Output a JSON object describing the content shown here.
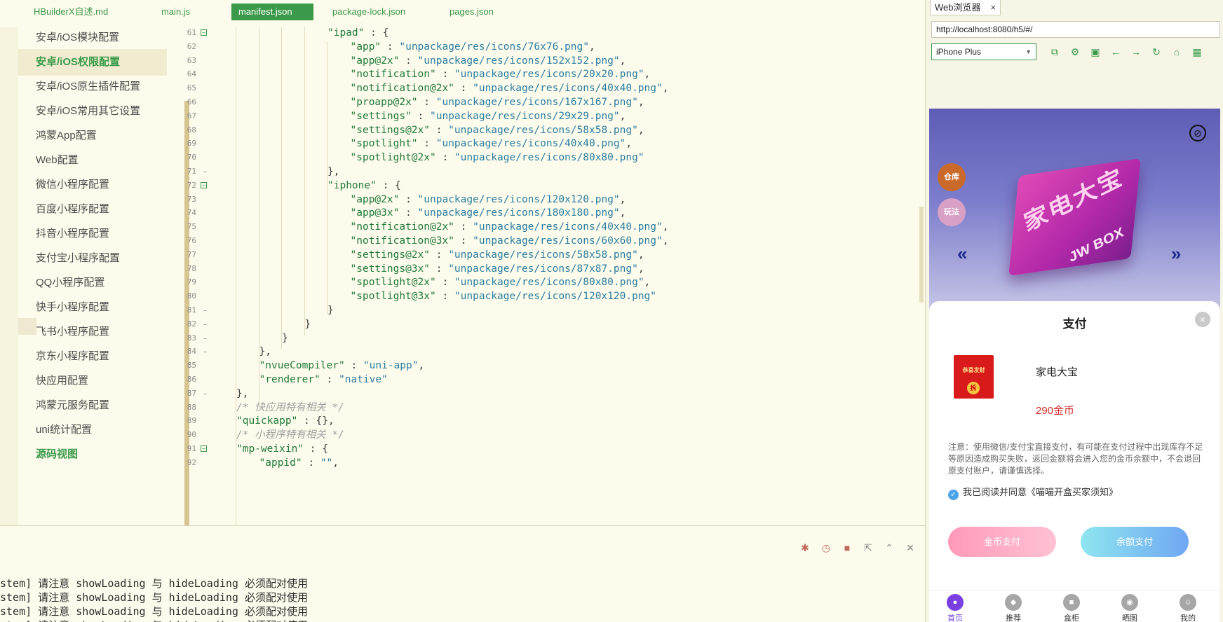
{
  "editor": {
    "tabs": [
      {
        "label": "HBuilderX自述.md",
        "active": false
      },
      {
        "label": "main.js",
        "active": false
      },
      {
        "label": "manifest.json",
        "active": true
      },
      {
        "label": "package-lock.json",
        "active": false
      },
      {
        "label": "pages.json",
        "active": false
      }
    ],
    "sidebar": [
      {
        "label": "安卓/iOS模块配置",
        "state": "normal"
      },
      {
        "label": "安卓/iOS权限配置",
        "state": "active"
      },
      {
        "label": "安卓/iOS原生插件配置",
        "state": "normal"
      },
      {
        "label": "安卓/iOS常用其它设置",
        "state": "normal"
      },
      {
        "label": "鸿蒙App配置",
        "state": "normal"
      },
      {
        "label": "Web配置",
        "state": "normal"
      },
      {
        "label": "微信小程序配置",
        "state": "normal"
      },
      {
        "label": "百度小程序配置",
        "state": "normal"
      },
      {
        "label": "抖音小程序配置",
        "state": "normal"
      },
      {
        "label": "支付宝小程序配置",
        "state": "normal"
      },
      {
        "label": "QQ小程序配置",
        "state": "normal"
      },
      {
        "label": "快手小程序配置",
        "state": "normal"
      },
      {
        "label": "飞书小程序配置",
        "state": "normal"
      },
      {
        "label": "京东小程序配置",
        "state": "normal"
      },
      {
        "label": "快应用配置",
        "state": "normal"
      },
      {
        "label": "鸿蒙元服务配置",
        "state": "normal"
      },
      {
        "label": "uni统计配置",
        "state": "normal"
      },
      {
        "label": "源码视图",
        "state": "link"
      }
    ],
    "code_lines": [
      {
        "n": "61",
        "fold": true,
        "indent": 4,
        "tokens": [
          [
            "k",
            "\"ipad\""
          ],
          [
            "p",
            " : {"
          ]
        ]
      },
      {
        "n": "62",
        "indent": 5,
        "tokens": [
          [
            "k",
            "\"app\""
          ],
          [
            "p",
            " : "
          ],
          [
            "s",
            "\"unpackage/res/icons/76x76.png\""
          ],
          [
            "p",
            ","
          ]
        ]
      },
      {
        "n": "63",
        "indent": 5,
        "tokens": [
          [
            "k",
            "\"app@2x\""
          ],
          [
            "p",
            " : "
          ],
          [
            "s",
            "\"unpackage/res/icons/152x152.png\""
          ],
          [
            "p",
            ","
          ]
        ]
      },
      {
        "n": "64",
        "indent": 5,
        "tokens": [
          [
            "k",
            "\"notification\""
          ],
          [
            "p",
            " : "
          ],
          [
            "s",
            "\"unpackage/res/icons/20x20.png\""
          ],
          [
            "p",
            ","
          ]
        ]
      },
      {
        "n": "65",
        "indent": 5,
        "tokens": [
          [
            "k",
            "\"notification@2x\""
          ],
          [
            "p",
            " : "
          ],
          [
            "s",
            "\"unpackage/res/icons/40x40.png\""
          ],
          [
            "p",
            ","
          ]
        ]
      },
      {
        "n": "66",
        "indent": 5,
        "tokens": [
          [
            "k",
            "\"proapp@2x\""
          ],
          [
            "p",
            " : "
          ],
          [
            "s",
            "\"unpackage/res/icons/167x167.png\""
          ],
          [
            "p",
            ","
          ]
        ]
      },
      {
        "n": "67",
        "indent": 5,
        "tokens": [
          [
            "k",
            "\"settings\""
          ],
          [
            "p",
            " : "
          ],
          [
            "s",
            "\"unpackage/res/icons/29x29.png\""
          ],
          [
            "p",
            ","
          ]
        ]
      },
      {
        "n": "68",
        "indent": 5,
        "tokens": [
          [
            "k",
            "\"settings@2x\""
          ],
          [
            "p",
            " : "
          ],
          [
            "s",
            "\"unpackage/res/icons/58x58.png\""
          ],
          [
            "p",
            ","
          ]
        ]
      },
      {
        "n": "69",
        "indent": 5,
        "tokens": [
          [
            "k",
            "\"spotlight\""
          ],
          [
            "p",
            " : "
          ],
          [
            "s",
            "\"unpackage/res/icons/40x40.png\""
          ],
          [
            "p",
            ","
          ]
        ]
      },
      {
        "n": "70",
        "indent": 5,
        "tokens": [
          [
            "k",
            "\"spotlight@2x\""
          ],
          [
            "p",
            " : "
          ],
          [
            "s",
            "\"unpackage/res/icons/80x80.png\""
          ]
        ]
      },
      {
        "n": "71",
        "tick": true,
        "indent": 4,
        "tokens": [
          [
            "p",
            "},"
          ]
        ]
      },
      {
        "n": "72",
        "fold": true,
        "indent": 4,
        "tokens": [
          [
            "k",
            "\"iphone\""
          ],
          [
            "p",
            " : {"
          ]
        ]
      },
      {
        "n": "73",
        "indent": 5,
        "tokens": [
          [
            "k",
            "\"app@2x\""
          ],
          [
            "p",
            " : "
          ],
          [
            "s",
            "\"unpackage/res/icons/120x120.png\""
          ],
          [
            "p",
            ","
          ]
        ]
      },
      {
        "n": "74",
        "indent": 5,
        "tokens": [
          [
            "k",
            "\"app@3x\""
          ],
          [
            "p",
            " : "
          ],
          [
            "s",
            "\"unpackage/res/icons/180x180.png\""
          ],
          [
            "p",
            ","
          ]
        ]
      },
      {
        "n": "75",
        "indent": 5,
        "tokens": [
          [
            "k",
            "\"notification@2x\""
          ],
          [
            "p",
            " : "
          ],
          [
            "s",
            "\"unpackage/res/icons/40x40.png\""
          ],
          [
            "p",
            ","
          ]
        ]
      },
      {
        "n": "76",
        "indent": 5,
        "tokens": [
          [
            "k",
            "\"notification@3x\""
          ],
          [
            "p",
            " : "
          ],
          [
            "s",
            "\"unpackage/res/icons/60x60.png\""
          ],
          [
            "p",
            ","
          ]
        ]
      },
      {
        "n": "77",
        "indent": 5,
        "tokens": [
          [
            "k",
            "\"settings@2x\""
          ],
          [
            "p",
            " : "
          ],
          [
            "s",
            "\"unpackage/res/icons/58x58.png\""
          ],
          [
            "p",
            ","
          ]
        ]
      },
      {
        "n": "78",
        "indent": 5,
        "tokens": [
          [
            "k",
            "\"settings@3x\""
          ],
          [
            "p",
            " : "
          ],
          [
            "s",
            "\"unpackage/res/icons/87x87.png\""
          ],
          [
            "p",
            ","
          ]
        ]
      },
      {
        "n": "79",
        "indent": 5,
        "tokens": [
          [
            "k",
            "\"spotlight@2x\""
          ],
          [
            "p",
            " : "
          ],
          [
            "s",
            "\"unpackage/res/icons/80x80.png\""
          ],
          [
            "p",
            ","
          ]
        ]
      },
      {
        "n": "80",
        "indent": 5,
        "tokens": [
          [
            "k",
            "\"spotlight@3x\""
          ],
          [
            "p",
            " : "
          ],
          [
            "s",
            "\"unpackage/res/icons/120x120.png\""
          ]
        ]
      },
      {
        "n": "81",
        "tick": true,
        "indent": 4,
        "tokens": [
          [
            "p",
            "}"
          ]
        ]
      },
      {
        "n": "82",
        "tick": true,
        "indent": 3,
        "tokens": [
          [
            "p",
            "}"
          ]
        ]
      },
      {
        "n": "83",
        "tick": true,
        "indent": 2,
        "tokens": [
          [
            "p",
            "}"
          ]
        ]
      },
      {
        "n": "84",
        "tick": true,
        "indent": 1,
        "tokens": [
          [
            "p",
            "},"
          ]
        ]
      },
      {
        "n": "85",
        "indent": 1,
        "tokens": [
          [
            "k",
            "\"nvueCompiler\""
          ],
          [
            "p",
            " : "
          ],
          [
            "s",
            "\"uni-app\""
          ],
          [
            "p",
            ","
          ]
        ]
      },
      {
        "n": "86",
        "indent": 1,
        "tokens": [
          [
            "k",
            "\"renderer\""
          ],
          [
            "p",
            " : "
          ],
          [
            "s",
            "\"native\""
          ]
        ]
      },
      {
        "n": "87",
        "tick": true,
        "indent": 0,
        "tokens": [
          [
            "p",
            "},"
          ]
        ]
      },
      {
        "n": "88",
        "indent": 0,
        "tokens": [
          [
            "c",
            "/* 快应用特有相关 */"
          ]
        ]
      },
      {
        "n": "89",
        "indent": 0,
        "tokens": [
          [
            "k",
            "\"quickapp\""
          ],
          [
            "p",
            " : {},"
          ]
        ]
      },
      {
        "n": "90",
        "indent": 0,
        "tokens": [
          [
            "c",
            "/* 小程序特有相关 */"
          ]
        ]
      },
      {
        "n": "91",
        "fold": true,
        "indent": 0,
        "tokens": [
          [
            "k",
            "\"mp-weixin\""
          ],
          [
            "p",
            " : {"
          ]
        ]
      },
      {
        "n": "92",
        "indent": 1,
        "tokens": [
          [
            "k",
            "\"appid\""
          ],
          [
            "p",
            " : "
          ],
          [
            "s",
            "\"\""
          ],
          [
            "p",
            ","
          ]
        ]
      }
    ],
    "console_lines": [
      "stem] 请注意 showLoading 与 hideLoading 必须配对使用",
      "stem] 请注意 showLoading 与 hideLoading 必须配对使用",
      "stem] 请注意 showLoading 与 hideLoading 必须配对使用",
      "stem] 请注意 showLoading 与 hideLoading 必须配对使用"
    ],
    "console_tools": [
      "bug-icon",
      "run-icon",
      "stop-icon",
      "export-icon",
      "collapse-up-icon",
      "clear-icon"
    ]
  },
  "browser": {
    "tab_label": "Web浏览器",
    "tab_close": "×",
    "url": "http://localhost:8080/h5/#/",
    "device": "iPhone Plus",
    "tools": [
      "screenshot-icon",
      "settings-icon",
      "console-icon",
      "back-icon",
      "forward-icon",
      "refresh-icon",
      "lock-icon",
      "qrcode-icon"
    ],
    "app": {
      "banner": {
        "box_text": "家电大宝",
        "box_brand": "JW BOX",
        "left_icons": [
          "仓库",
          "玩法"
        ]
      },
      "sheet": {
        "title": "支付",
        "close": "×",
        "product_name": "家电大宝",
        "product_image_caption": "恭喜发财",
        "product_image_badge": "拆",
        "price": "290金币",
        "notice": "注意：使用微信/支付宝直接支付，有可能在支付过程中出现库存不足等原因造成购买失败，返回金额将会进入您的金币余额中，不会退回原支付账户，请谨慎选择。",
        "agree_text": "我已阅读并同意《喵喵开盒买家须知》",
        "agreed": true,
        "btn_coin": "金币支付",
        "btn_balance": "余额支付"
      },
      "nav": [
        {
          "label": "首页",
          "active": true
        },
        {
          "label": "推荐",
          "active": false
        },
        {
          "label": "盒柜",
          "active": false
        },
        {
          "label": "晒图",
          "active": false
        },
        {
          "label": "我的",
          "active": false
        }
      ]
    }
  },
  "colors": {
    "accent_green": "#3a9a4a",
    "price_red": "#d62b2b",
    "nav_active": "#7a3fe0"
  }
}
